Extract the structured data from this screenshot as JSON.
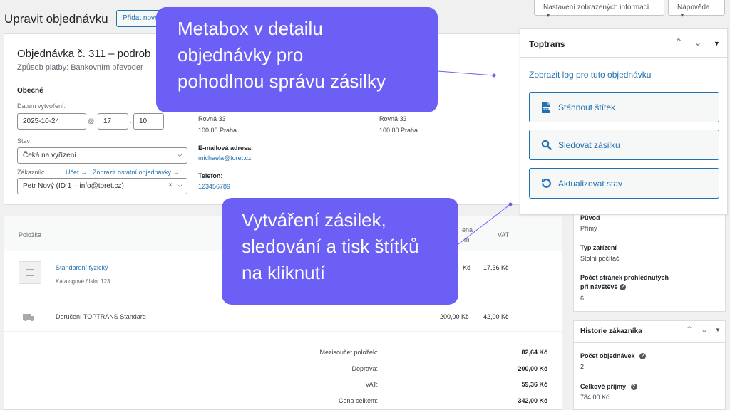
{
  "header": {
    "title": "Upravit objednávku",
    "add_new": "Přidat nové",
    "screen_options": "Nastavení zobrazených informací",
    "help": "Nápověda"
  },
  "order": {
    "title": "Objednávka č. 311 – podrob",
    "payment": "Způsob platby: Bankovním převoder",
    "general": "Obecné",
    "created_label": "Datum vytvoření:",
    "date": "2025-10-24",
    "at": "@",
    "hour": "17",
    "colon": ":",
    "minute": "10",
    "status_label": "Stav:",
    "status": "Čeká na vyřízení",
    "customer_label": "Zákazník:",
    "profile_link": "Účet →",
    "other_orders_link": "Zobrazit ostatní objednávky →",
    "customer": "Petr Nový (ID 1 – info@toret.cz)",
    "billing_street": "Rovná 33",
    "billing_city": "100 00 Praha",
    "shipping_street": "Rovná 33",
    "shipping_city": "100 00 Praha",
    "email_label": "E-mailová adresa:",
    "email": "michaela@toret.cz",
    "phone_label": "Telefon:",
    "phone": "123456789"
  },
  "items": {
    "col_item": "Položka",
    "col_price_partial": "ena",
    "col_price_partial2": "m",
    "col_vat": "VAT",
    "product_name": "Standardní fyzický",
    "product_sku": "Katalogové číslo: 123",
    "product_total_partial": "Kč",
    "product_vat": "17,36 Kč",
    "shipping_name": "Doručení TOPTRANS Standard",
    "shipping_total": "200,00 Kč",
    "shipping_vat": "42,00 Kč",
    "totals": [
      {
        "label": "Mezisoučet položek:",
        "value": "82,64 Kč"
      },
      {
        "label": "Doprava:",
        "value": "200,00 Kč"
      },
      {
        "label": "VAT:",
        "value": "59,36 Kč"
      },
      {
        "label": "Cena celkem:",
        "value": "342,00 Kč"
      }
    ]
  },
  "toptrans": {
    "title": "Toptrans",
    "log_link": "Zobrazit log pro tuto objednávku",
    "download": "Stáhnout štítek",
    "track": "Sledovat zásilku",
    "update": "Aktualizovat stav"
  },
  "attribution": {
    "origin_label": "Původ",
    "origin": "Přímý",
    "device_label": "Typ zařízení",
    "device": "Stolní počítač",
    "pages_label_1": "Počet stránek prohlédnutých",
    "pages_label_2": "při návštěvě",
    "pages": "6"
  },
  "history": {
    "title": "Historie zákazníka",
    "orders_label": "Počet objednávek",
    "orders": "2",
    "revenue_label": "Celkové příjmy",
    "revenue": "784,00 Kč"
  },
  "callouts": {
    "top": [
      "Metabox v detailu",
      "objednávky pro",
      "pohodlnou správu zásilky"
    ],
    "bottom": [
      "Vytváření zásilek,",
      "sledování a tisk štítků",
      "na kliknutí"
    ]
  },
  "colors": {
    "accent": "#6c5ff6",
    "link": "#2271b1"
  }
}
